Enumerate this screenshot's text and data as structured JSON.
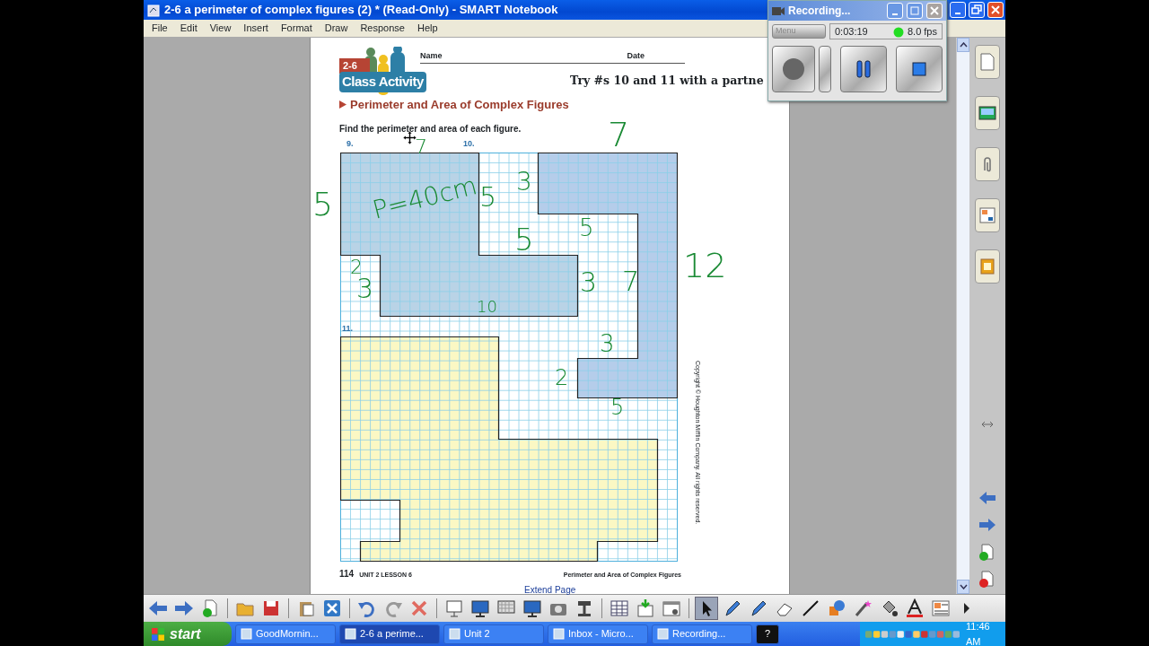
{
  "window": {
    "title": "2-6 a perimeter of complex figures (2) * (Read-Only) - SMART Notebook"
  },
  "menu": [
    "File",
    "Edit",
    "View",
    "Insert",
    "Format",
    "Draw",
    "Response",
    "Help"
  ],
  "worksheet": {
    "lesson_badge": "2-6",
    "logo_text": "Class Activity",
    "name_label": "Name",
    "date_label": "Date",
    "prompt": "Try #s 10 and 11 with a partne",
    "heading": "Perimeter and Area of Complex Figures",
    "instruction": "Find the perimeter and area of each figure.",
    "problem_labels": [
      "9.",
      "10.",
      "11."
    ],
    "handwritten_notes": [
      {
        "text": "7"
      },
      {
        "text": "7"
      },
      {
        "text": "3"
      },
      {
        "text": "5"
      },
      {
        "text": "P=40cm"
      },
      {
        "text": "5"
      },
      {
        "text": "5"
      },
      {
        "text": "5"
      },
      {
        "text": "2"
      },
      {
        "text": "3"
      },
      {
        "text": "3"
      },
      {
        "text": "7"
      },
      {
        "text": "12"
      },
      {
        "text": "10"
      },
      {
        "text": "3"
      },
      {
        "text": "2"
      },
      {
        "text": "5"
      }
    ],
    "copyright": "Copyright © Houghton Mifflin Company. All rights reserved.",
    "page_number": "114",
    "unit_label": "UNIT 2 LESSON 6",
    "footer_title": "Perimeter and Area of Complex Figures"
  },
  "extend_page": "Extend Page",
  "sidebar_tabs": [
    {
      "kind": "pages"
    },
    {
      "kind": "gallery"
    },
    {
      "kind": "attachments"
    },
    {
      "kind": "properties"
    },
    {
      "kind": "addons"
    }
  ],
  "toolbar": [
    {
      "kind": "back",
      "selected": false
    },
    {
      "kind": "forward",
      "selected": false
    },
    {
      "kind": "addpage",
      "selected": false
    },
    {
      "kind": "separator"
    },
    {
      "kind": "open",
      "selected": false
    },
    {
      "kind": "save",
      "selected": false
    },
    {
      "kind": "separator"
    },
    {
      "kind": "paste",
      "selected": false
    },
    {
      "kind": "clear",
      "selected": false
    },
    {
      "kind": "separator"
    },
    {
      "kind": "undo",
      "selected": false
    },
    {
      "kind": "redo",
      "selected": false
    },
    {
      "kind": "delete",
      "selected": false
    },
    {
      "kind": "separator"
    },
    {
      "kind": "screen",
      "selected": false
    },
    {
      "kind": "monitor",
      "selected": false
    },
    {
      "kind": "checker",
      "selected": false
    },
    {
      "kind": "monitor",
      "selected": false
    },
    {
      "kind": "camera",
      "selected": false
    },
    {
      "kind": "projector",
      "selected": false
    },
    {
      "kind": "separator"
    },
    {
      "kind": "table",
      "selected": false
    },
    {
      "kind": "download",
      "selected": false
    },
    {
      "kind": "window",
      "selected": false
    },
    {
      "kind": "separator"
    },
    {
      "kind": "select",
      "selected": true
    },
    {
      "kind": "pen",
      "selected": false
    },
    {
      "kind": "pen",
      "selected": false
    },
    {
      "kind": "eraser",
      "selected": false
    },
    {
      "kind": "line",
      "selected": false
    },
    {
      "kind": "shapes",
      "selected": false
    },
    {
      "kind": "wand",
      "selected": false
    },
    {
      "kind": "fill",
      "selected": false
    },
    {
      "kind": "text",
      "selected": false
    },
    {
      "kind": "properties",
      "selected": false
    },
    {
      "kind": "more",
      "selected": false
    }
  ],
  "recorder": {
    "title": "Recording...",
    "menu_button": "Menu",
    "elapsed": "0:03:19",
    "frame_rate": "8.0 fps",
    "active": true
  },
  "taskbar": {
    "start": "start",
    "items": [
      {
        "label": "GoodMornin...",
        "selected": false
      },
      {
        "label": "2-6 a perime...",
        "selected": true
      },
      {
        "label": "Unit 2",
        "selected": false
      },
      {
        "label": "Inbox - Micro...",
        "selected": false
      },
      {
        "label": "Recording...",
        "selected": false
      }
    ],
    "help_button": "?",
    "clock": "11:46 AM"
  }
}
